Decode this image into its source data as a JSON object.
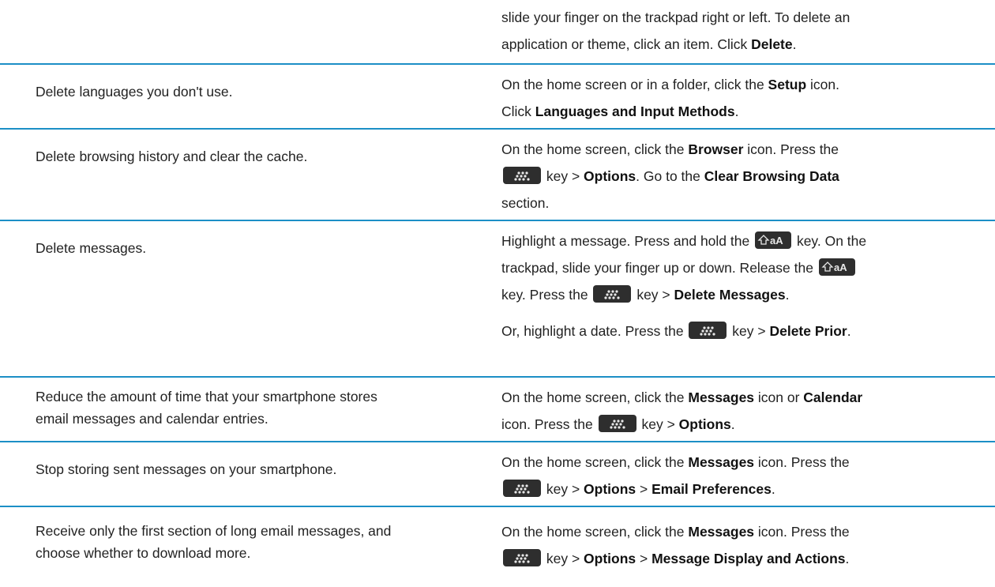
{
  "colors": {
    "rule": "#1c8fc6",
    "key_bg": "#2e2e2e",
    "key_fg": "#e8e8e8"
  },
  "top_row": {
    "line1": "slide your finger on the trackpad right or left. To delete an",
    "line2_pre": "application or theme, click an item. Click ",
    "line2_bold": "Delete",
    "line2_post": "."
  },
  "rows": [
    {
      "task": "Delete languages you don't use.",
      "a_t1": "On the home screen or in a folder, click the ",
      "a_b1": "Setup",
      "a_t2": " icon.",
      "a_t3": "Click ",
      "a_b2": "Languages and Input Methods",
      "a_t4": "."
    },
    {
      "task": "Delete browsing history and clear the cache.",
      "a_t1": "On the home screen, click the ",
      "a_b1": "Browser",
      "a_t2": " icon. Press the",
      "a_t3": " key > ",
      "a_b2": "Options",
      "a_t4": ". Go to the ",
      "a_b3": "Clear Browsing Data",
      "a_t5": "section."
    },
    {
      "task": "Delete messages.",
      "a_t1": "Highlight a message. Press and hold the ",
      "a_t2": " key. On the",
      "a_t3": "trackpad, slide your finger up or down. Release the ",
      "a_t4": "key. Press the ",
      "a_t5": " key > ",
      "a_b1": "Delete Messages",
      "a_t6": ".",
      "p2_t1": "Or, highlight a date. Press the ",
      "p2_t2": " key > ",
      "p2_b1": "Delete Prior",
      "p2_t3": "."
    },
    {
      "task_line1": "Reduce the amount of time that your smartphone stores",
      "task_line2": "email messages and calendar entries.",
      "a_t1": "On the home screen, click the ",
      "a_b1": "Messages",
      "a_t2": " icon or ",
      "a_b2": "Calendar",
      "a_t3": "icon. Press the ",
      "a_t4": " key > ",
      "a_b3": "Options",
      "a_t5": "."
    },
    {
      "task": "Stop storing sent messages on your smartphone.",
      "a_t1": "On the home screen, click the ",
      "a_b1": "Messages",
      "a_t2": " icon. Press the",
      "a_t3": " key > ",
      "a_b2": "Options",
      "a_t4": " > ",
      "a_b3": "Email Preferences",
      "a_t5": "."
    },
    {
      "task_line1": "Receive only the first section of long email messages, and",
      "task_line2": "choose whether to download more.",
      "a_t1": "On the home screen, click the ",
      "a_b1": "Messages",
      "a_t2": " icon. Press the",
      "a_t3": " key > ",
      "a_b2": "Options",
      "a_t4": " > ",
      "a_b3": "Message Display and Actions",
      "a_t5": "."
    }
  ]
}
